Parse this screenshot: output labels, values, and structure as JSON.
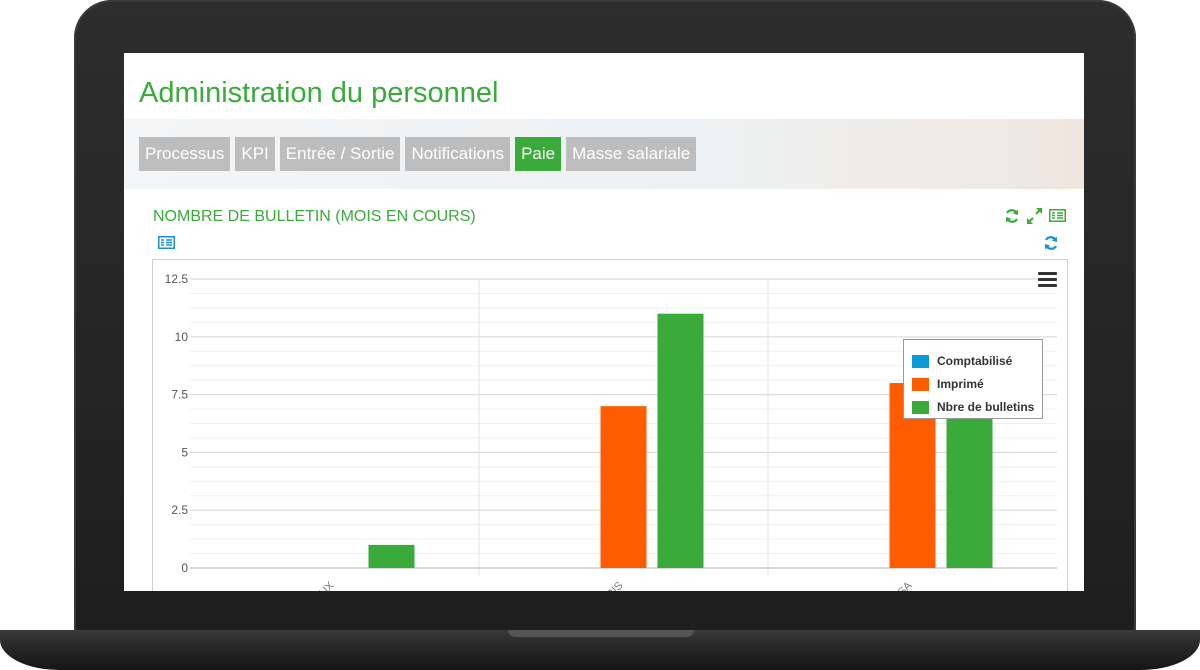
{
  "app": {
    "title": "Administration du personnel"
  },
  "tabs": [
    {
      "label": "Processus",
      "active": false
    },
    {
      "label": "KPI",
      "active": false
    },
    {
      "label": "Entrée / Sortie",
      "active": false
    },
    {
      "label": "Notifications",
      "active": false
    },
    {
      "label": "Paie",
      "active": true
    },
    {
      "label": "Masse salariale",
      "active": false
    }
  ],
  "panel": {
    "title": "NOMBRE DE BULLETIN (MOIS EN COURS)",
    "icons": [
      "refresh-icon",
      "expand-icon",
      "table-view-icon",
      "table-view-icon",
      "refresh-icon",
      "menu-icon"
    ]
  },
  "colors": {
    "accent": "#3aab3a",
    "tab_inactive": "#bdbdbd",
    "comptabilise": "#0e9ad6",
    "imprime": "#ff5c00",
    "bulletins": "#3aab3a"
  },
  "chart_data": {
    "type": "bar",
    "categories": [
      "…UX",
      "…RIS",
      "…SA"
    ],
    "series": [
      {
        "name": "Comptabilisé",
        "values": [
          0,
          0,
          0
        ]
      },
      {
        "name": "Imprimé",
        "values": [
          0,
          7,
          8
        ]
      },
      {
        "name": "Nbre de bulletins",
        "values": [
          1,
          11,
          8
        ]
      }
    ],
    "ylim": [
      0,
      12.5
    ],
    "yticks": [
      "0",
      "2.5",
      "5",
      "7.5",
      "10",
      "12.5"
    ],
    "grid": true,
    "legend": "top-right"
  }
}
